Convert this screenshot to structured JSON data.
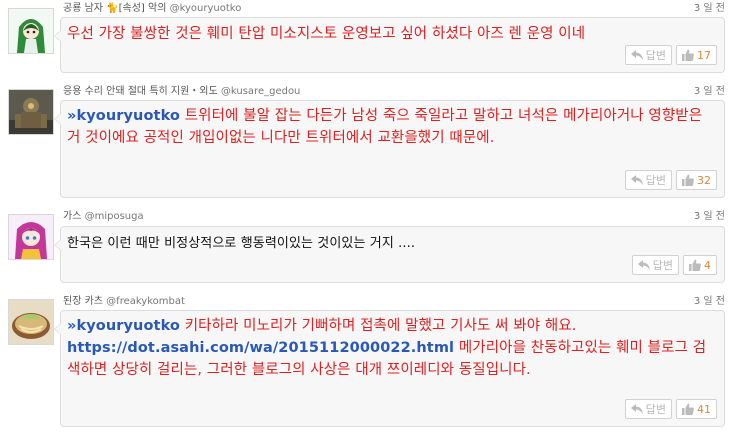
{
  "comments": [
    {
      "author": "공룡 남자 🐈[속성] 악의",
      "handle": "@kyouryuotko",
      "time": "3 일 전",
      "text": "우선 가장 불쌍한 것은 훼미 탄압 미소지스토 운영보고 싶어 하셨다 아즈 렌 운영 이네",
      "reply_label": "답변",
      "likes": "17"
    },
    {
      "author": "응용 수리 안돼 절대 특히 지원・외도",
      "handle": "@kusare_gedou",
      "time": "3 일 전",
      "mention": "»kyouryuotko",
      "text": " 트위터에 불알 잡는 다든가 남성 죽으 죽일라고 말하고 녀석은 메가리아거나 영향받은 거 것이에요 공적인 개입이없는 니다만 트위터에서 교환을했기 때문에.",
      "reply_label": "답변",
      "likes": "32"
    },
    {
      "author": "가스",
      "handle": "@miposuga",
      "time": "3 일 전",
      "text": "한국은 이런 때만 비정상적으로 행동력이있는 것이있는 거지 ....",
      "reply_label": "답변",
      "likes": "4"
    },
    {
      "author": "된장 카츠",
      "handle": "@freakykombat",
      "time": "3 일 전",
      "mention": "»kyouryuotko",
      "text_a": " 키타하라 미노리가 기뻐하며 접촉에 말했고 기사도 써 봐야 해요. ",
      "link": "https://dot.asahi.com/wa/2015112000022.html",
      "text_b": " 메가리아을 찬동하고있는 훼미 블로그 검색하면 상당히 걸리는, 그러한 블로그의 사상은 대개 쯔이레디와 동질입니다.",
      "reply_label": "답변",
      "likes": "41"
    }
  ]
}
